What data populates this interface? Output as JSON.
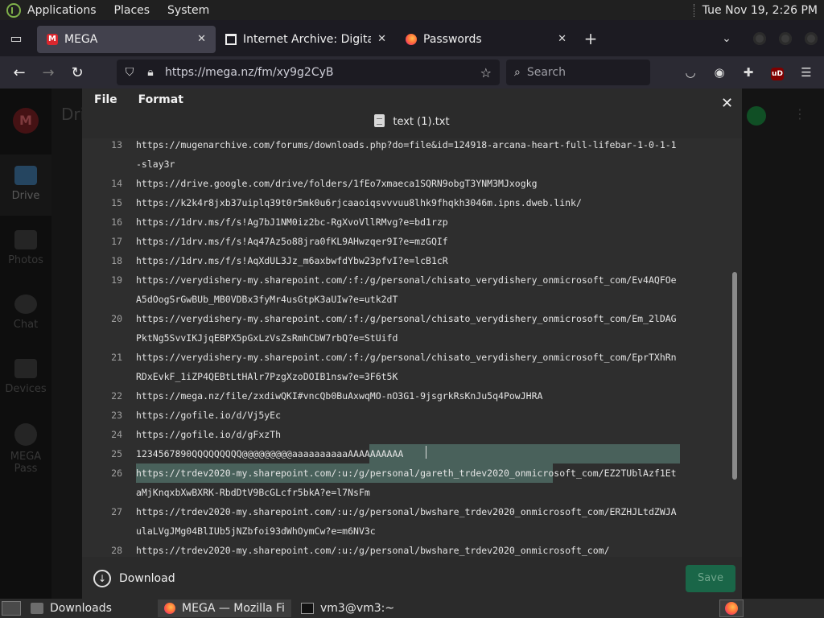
{
  "top_panel": {
    "menus": [
      "Applications",
      "Places",
      "System"
    ],
    "clock": "Tue Nov 19,  2:26 PM"
  },
  "browser": {
    "tabs": [
      {
        "label": "MEGA",
        "favicon": "mega-icon",
        "active": true
      },
      {
        "label": "Internet Archive: Digital Libr",
        "favicon": "internet-archive-icon",
        "active": false
      },
      {
        "label": "Passwords",
        "favicon": "firefox-icon",
        "active": false
      }
    ],
    "url": "https://mega.nz/fm/xy9g2CyB",
    "search_placeholder": "Search"
  },
  "mega_bg": {
    "title": "Dri",
    "nav": [
      "Drive",
      "Photos",
      "Chat",
      "Devices",
      "MEGA Pass"
    ]
  },
  "editor": {
    "menu": [
      "File",
      "Format"
    ],
    "filename": "text (1).txt",
    "lines": [
      {
        "n": "13",
        "text": "https://mugenarchive.com/forums/downloads.php?do=file&id=124918-arcana-heart-full-lifebar-1-0-1-1-slay3r"
      },
      {
        "n": "14",
        "text": "https://drive.google.com/drive/folders/1fEo7xmaeca1SQRN9obgT3YNM3MJxogkg"
      },
      {
        "n": "15",
        "text": "https://k2k4r8jxb37uiplq39t0r5mk0u6rjcaaoiqsvvvuu8lhk9fhqkh3046m.ipns.dweb.link/"
      },
      {
        "n": "16",
        "text": "https://1drv.ms/f/s!Ag7bJ1NM0iz2bc-RgXvoVllRMvg?e=bd1rzp"
      },
      {
        "n": "17",
        "text": "https://1drv.ms/f/s!Aq47Az5o88jra0fKL9AHwzqer9I?e=mzGQIf"
      },
      {
        "n": "18",
        "text": "https://1drv.ms/f/s!AqXdUL3Jz_m6axbwfdYbw23pfvI?e=lcB1cR"
      },
      {
        "n": "19",
        "text": "https://verydishery-my.sharepoint.com/:f:/g/personal/chisato_verydishery_onmicrosoft_com/Ev4AQFOeA5dOogSrGwBUb_MB0VDBx3fyMr4usGtpK3aUIw?e=utk2dT"
      },
      {
        "n": "20",
        "text": "https://verydishery-my.sharepoint.com/:f:/g/personal/chisato_verydishery_onmicrosoft_com/Em_2lDAGPktNg5SvvIKJjqEBPX5pGxLzVsZsRmhCbW7rbQ?e=StUifd"
      },
      {
        "n": "21",
        "text": "https://verydishery-my.sharepoint.com/:f:/g/personal/chisato_verydishery_onmicrosoft_com/EprTXhRnRDxEvkF_1iZP4QEBtLtHAlr7PzgXzoDOIB1nsw?e=3F6t5K"
      },
      {
        "n": "22",
        "text": "https://mega.nz/file/zxdiwQKI#vncQb0BuAxwqMO-nO3G1-9jsgrkRsKnJu5q4PowJHRA"
      },
      {
        "n": "23",
        "text": "https://gofile.io/d/Vj5yEc"
      },
      {
        "n": "24",
        "text": "https://gofile.io/d/gFxzTh"
      },
      {
        "n": "25",
        "text": "1234567890QQQQQQQQQ@@@@@@@@@aaaaaaaaaaAAAAAAAAAA"
      },
      {
        "n": "26",
        "text": "https://trdev2020-my.sharepoint.com/:u:/g/personal/gareth_trdev2020_onmicrosoft_com/EZ2TUblAzf1EtaMjKnqxbXwBXRK-RbdDtV9BcGLcfr5bkA?e=l7NsFm"
      },
      {
        "n": "27",
        "text": "https://trdev2020-my.sharepoint.com/:u:/g/personal/bwshare_trdev2020_onmicrosoft_com/ERZHJLtdZWJAulaLVgJMg04BlIUb5jNZbfoi93dWhOymCw?e=m6NV3c"
      },
      {
        "n": "28",
        "text": "https://trdev2020-my.sharepoint.com/:u:/g/personal/bwshare_trdev2020_onmicrosoft_com/"
      }
    ],
    "download_label": "Download",
    "save_label": "Save"
  },
  "taskbar": {
    "items": [
      {
        "label": "Downloads",
        "icon": "folder-icon"
      },
      {
        "label": "MEGA — Mozilla Fir...",
        "icon": "firefox-icon"
      },
      {
        "label": "vm3@vm3:~",
        "icon": "terminal-icon"
      }
    ]
  },
  "colors": {
    "selection": "#4c6761",
    "save_button": "#1a6648",
    "mega_red": "#d9272e"
  }
}
